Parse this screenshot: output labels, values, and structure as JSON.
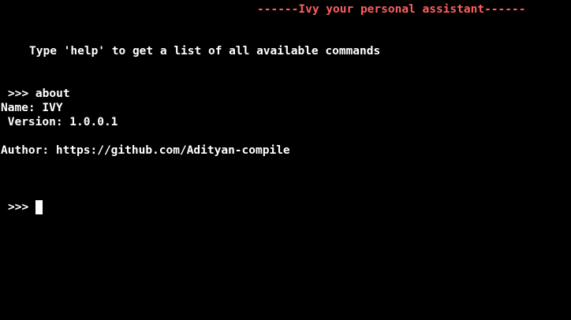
{
  "banner": "------Ivy your personal assistant------",
  "help_hint": "Type 'help' to get a list of all available commands",
  "history": {
    "prompt_line": ">>> about",
    "name_line": "Name: IVY",
    "version_line": " Version: 1.0.0.1",
    "author_line": "Author: https://github.com/Adityan-compile"
  },
  "current_prompt": ">>> ",
  "colors": {
    "background": "#000000",
    "text": "#ffffff",
    "banner": "#ff5f5f"
  }
}
